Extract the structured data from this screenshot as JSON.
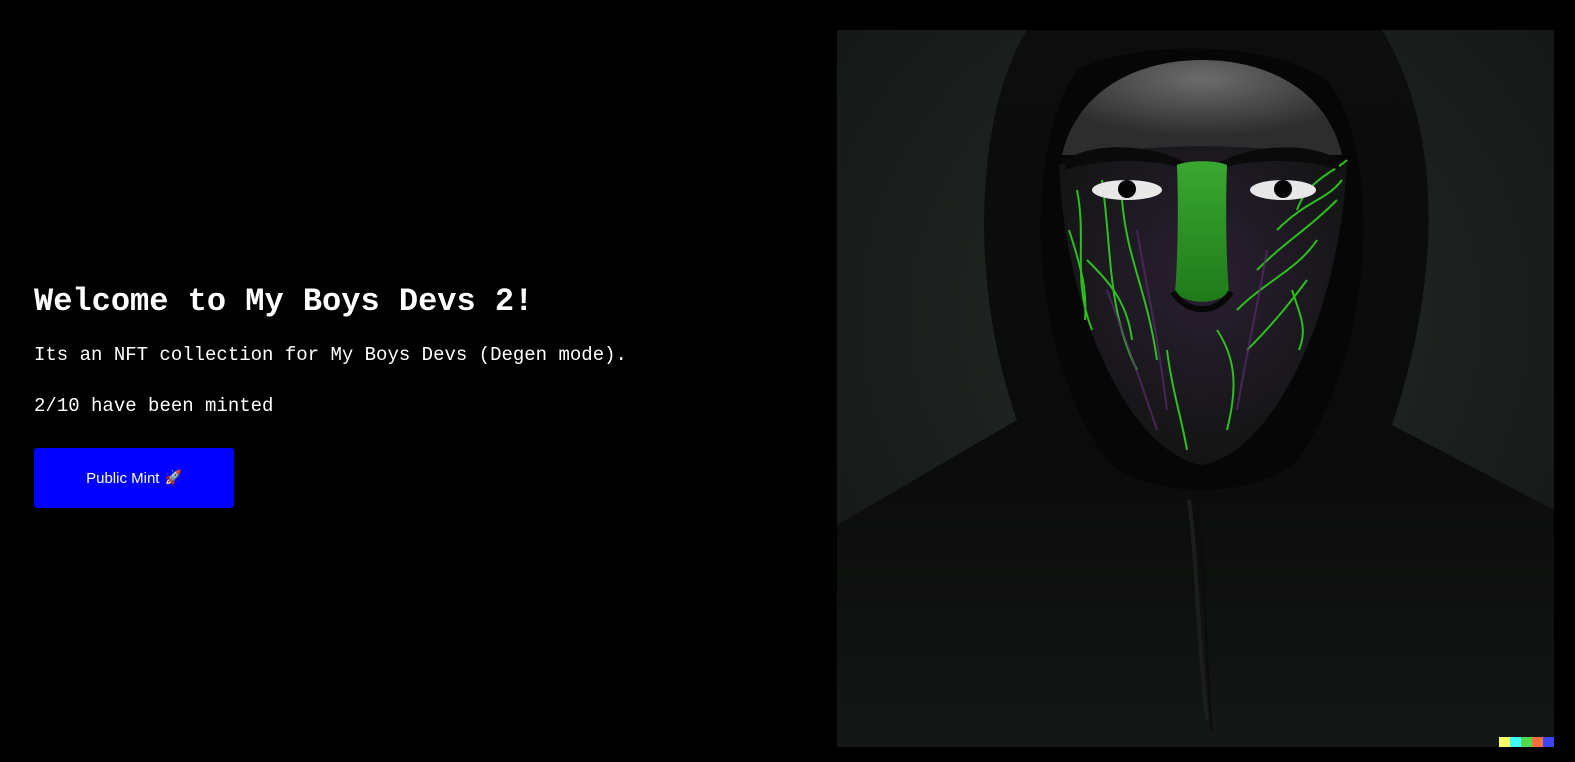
{
  "hero": {
    "title": "Welcome to My Boys Devs 2!",
    "description": "Its an NFT collection for My Boys Devs (Degen mode).",
    "minted_count": "2",
    "minted_total": "10",
    "minted_suffix": " have been minted",
    "mint_button_label": "Public Mint",
    "mint_button_icon": "rocket-icon",
    "mint_button_glyph": "🚀"
  },
  "artwork": {
    "subject": "hooded figure with green-streaked mask",
    "signature_colors": [
      "#ffff66",
      "#42ffff",
      "#51da4c",
      "#ff6e3c",
      "#3c46ff"
    ]
  },
  "colors": {
    "background": "#000000",
    "text": "#ffffff",
    "button": "#0000ff",
    "accent_green": "#2fd21f"
  }
}
